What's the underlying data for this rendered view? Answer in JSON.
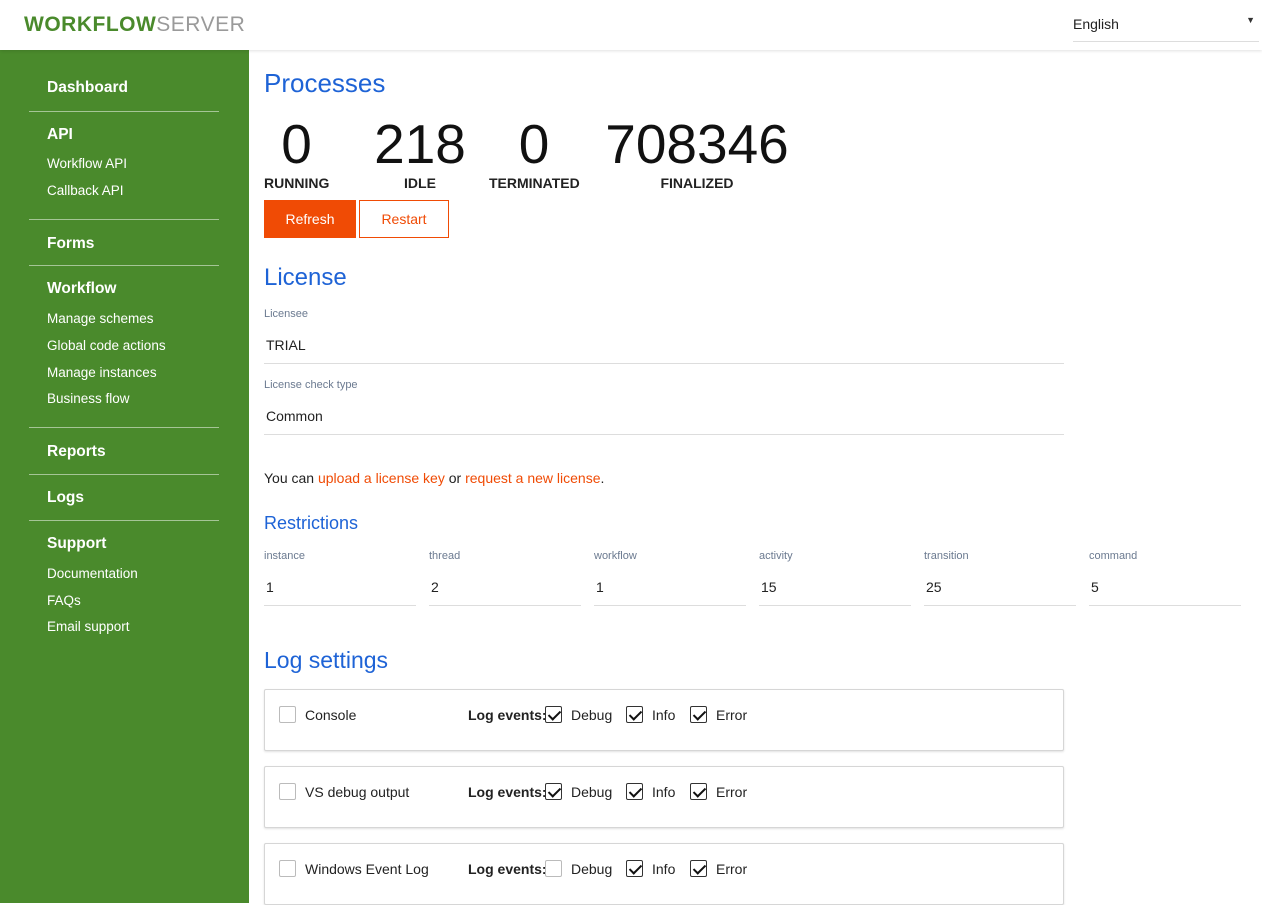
{
  "header": {
    "logo_strong": "WORKFLOW",
    "logo_light": "SERVER",
    "language": "English"
  },
  "sidebar": {
    "dashboard": "Dashboard",
    "api": "API",
    "workflow_api": "Workflow API",
    "callback_api": "Callback API",
    "forms": "Forms",
    "workflow": "Workflow",
    "manage_schemes": "Manage schemes",
    "global_code_actions": "Global code actions",
    "manage_instances": "Manage instances",
    "business_flow": "Business flow",
    "reports": "Reports",
    "logs": "Logs",
    "support": "Support",
    "documentation": "Documentation",
    "faqs": "FAQs",
    "email_support": "Email support"
  },
  "processes": {
    "title": "Processes",
    "stats": [
      {
        "value": "0",
        "label": "RUNNING"
      },
      {
        "value": "218",
        "label": "IDLE"
      },
      {
        "value": "0",
        "label": "TERMINATED"
      },
      {
        "value": "708346",
        "label": "FINALIZED"
      }
    ],
    "refresh_label": "Refresh",
    "restart_label": "Restart"
  },
  "license": {
    "title": "License",
    "licensee_label": "Licensee",
    "licensee_value": "TRIAL",
    "check_type_label": "License check type",
    "check_type_value": "Common",
    "note_prefix": "You can ",
    "upload_link": "upload a license key",
    "note_middle": " or ",
    "request_link": "request a new license",
    "note_suffix": "."
  },
  "restrictions": {
    "title": "Restrictions",
    "items": [
      {
        "label": "instance",
        "value": "1"
      },
      {
        "label": "thread",
        "value": "2"
      },
      {
        "label": "workflow",
        "value": "1"
      },
      {
        "label": "activity",
        "value": "15"
      },
      {
        "label": "transition",
        "value": "25"
      },
      {
        "label": "command",
        "value": "5"
      }
    ]
  },
  "log_settings": {
    "title": "Log settings",
    "events_label": "Log events:",
    "debug_label": "Debug",
    "info_label": "Info",
    "error_label": "Error",
    "targets": [
      {
        "name": "Console",
        "enabled": false,
        "debug": true,
        "info": true,
        "error": true
      },
      {
        "name": "VS debug output",
        "enabled": false,
        "debug": true,
        "info": true,
        "error": true
      },
      {
        "name": "Windows Event Log",
        "enabled": false,
        "debug": false,
        "info": true,
        "error": true
      }
    ]
  }
}
